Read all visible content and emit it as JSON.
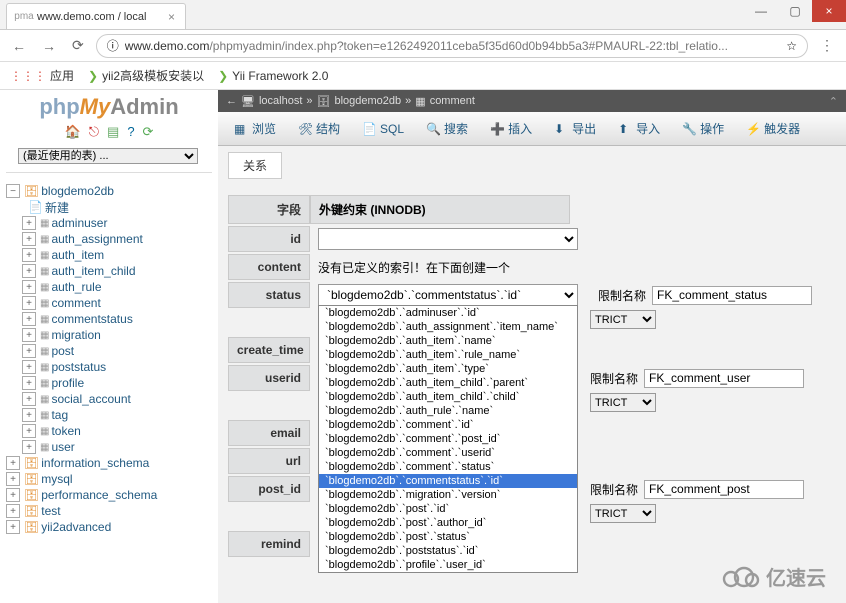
{
  "browser": {
    "tab_title": "www.demo.com / local",
    "url_prefix": "www.demo.com",
    "url": "/phpmyadmin/index.php?token=e1262492011ceba5f35d60d0b94bb5a3#PMAURL-22:tbl_relatio..."
  },
  "bookmarks": {
    "apps_label": "应用",
    "items": [
      "yii2高级模板安装以",
      "Yii Framework 2.0"
    ]
  },
  "logo": {
    "part1": "php",
    "part2": "My",
    "part3": "Admin"
  },
  "recent_placeholder": "(最近使用的表) ...",
  "tree": {
    "db_open": "blogdemo2db",
    "new_label": "新建",
    "tables": [
      "adminuser",
      "auth_assignment",
      "auth_item",
      "auth_item_child",
      "auth_rule",
      "comment",
      "commentstatus",
      "migration",
      "post",
      "poststatus",
      "profile",
      "social_account",
      "tag",
      "token",
      "user"
    ],
    "other_dbs": [
      "information_schema",
      "mysql",
      "performance_schema",
      "test",
      "yii2advanced"
    ]
  },
  "breadcrumb": {
    "server": "localhost",
    "db": "blogdemo2db",
    "table": "comment"
  },
  "tabs": {
    "browse": "浏览",
    "structure": "结构",
    "sql": "SQL",
    "search": "搜索",
    "insert": "插入",
    "export": "导出",
    "import": "导入",
    "operations": "操作",
    "triggers": "触发器"
  },
  "subtab_relation": "关系",
  "form": {
    "field_header": "字段",
    "fk_header": "外键约束 (INNODB)",
    "constraint_label": "限制名称",
    "rows": {
      "id": "id",
      "content": "content",
      "content_text": "没有已定义的索引！在下面创建一个",
      "status": "status",
      "status_value": "`blogdemo2db`.`commentstatus`.`id`",
      "status_cname": "FK_comment_status",
      "create_time": "create_time",
      "userid": "userid",
      "userid_cname": "FK_comment_user",
      "email": "email",
      "url": "url",
      "post_id": "post_id",
      "post_id_cname": "FK_comment_post",
      "remind": "remind"
    },
    "action_value": "TRICT"
  },
  "dropdown_options": [
    "`blogdemo2db`.`adminuser`.`id`",
    "`blogdemo2db`.`auth_assignment`.`item_name`",
    "`blogdemo2db`.`auth_item`.`name`",
    "`blogdemo2db`.`auth_item`.`rule_name`",
    "`blogdemo2db`.`auth_item`.`type`",
    "`blogdemo2db`.`auth_item_child`.`parent`",
    "`blogdemo2db`.`auth_item_child`.`child`",
    "`blogdemo2db`.`auth_rule`.`name`",
    "`blogdemo2db`.`comment`.`id`",
    "`blogdemo2db`.`comment`.`post_id`",
    "`blogdemo2db`.`comment`.`userid`",
    "`blogdemo2db`.`comment`.`status`",
    "`blogdemo2db`.`commentstatus`.`id`",
    "`blogdemo2db`.`migration`.`version`",
    "`blogdemo2db`.`post`.`id`",
    "`blogdemo2db`.`post`.`author_id`",
    "`blogdemo2db`.`post`.`status`",
    "`blogdemo2db`.`poststatus`.`id`",
    "`blogdemo2db`.`profile`.`user_id`"
  ],
  "dropdown_selected_index": 12,
  "watermark": "亿速云"
}
